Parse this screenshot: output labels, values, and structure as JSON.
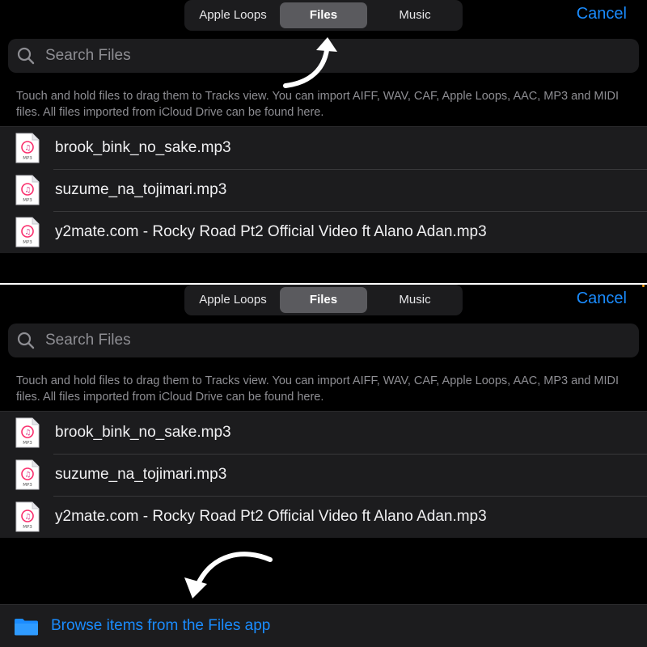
{
  "tabs": [
    "Apple Loops",
    "Files",
    "Music"
  ],
  "selected_tab": "Files",
  "cancel_label": "Cancel",
  "search": {
    "placeholder": "Search Files"
  },
  "info_text": "Touch and hold files to drag them to Tracks view. You can import AIFF, WAV, CAF, Apple Loops, AAC, MP3 and MIDI files. All files imported from iCloud Drive can be found here.",
  "files": [
    {
      "name": "brook_bink_no_sake.mp3",
      "badge": "MP3"
    },
    {
      "name": "suzume_na_tojimari.mp3",
      "badge": "MP3"
    },
    {
      "name": "y2mate.com - Rocky Road Pt2  Official Video ft Alano Adan.mp3",
      "badge": "MP3"
    }
  ],
  "browse": {
    "label": "Browse items from the Files app",
    "icon": "folder-icon"
  },
  "colors": {
    "accent": "#1a8cff",
    "background": "#000000",
    "row": "#1c1c1e"
  }
}
